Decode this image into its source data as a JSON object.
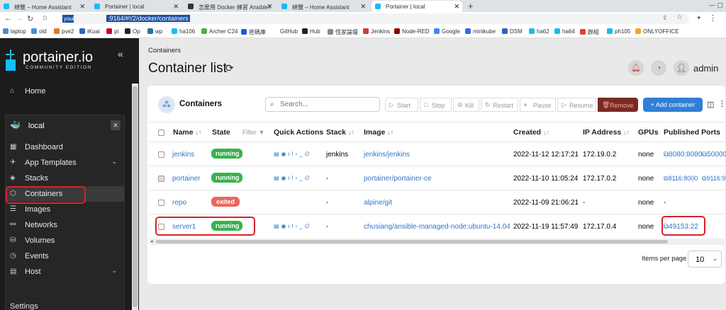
{
  "browser": {
    "tabs": [
      {
        "title": "總覽 – Home Assistant",
        "color": "#18bcf2"
      },
      {
        "title": "Portainer | local",
        "color": "#13bef9"
      },
      {
        "title": "怎麼用 Docker 練習 Ansible？",
        "color": "#333333"
      },
      {
        "title": "總覽 – Home Assistant",
        "color": "#18bcf2"
      },
      {
        "title": "Portainer | local",
        "color": "#13bef9"
      }
    ],
    "url_host": "youl",
    "url_path": ":9164/#!/2/docker/containers",
    "bookmarks": [
      "laptop",
      "old",
      "pve2",
      "iKuai",
      "pi",
      "Op",
      "wp",
      "ha106",
      "Archer C24",
      "密碼庫",
      "GitHub",
      "Hub",
      "恆家論壇",
      "Jenkins",
      "Node-RED",
      "Google",
      "minikube",
      "DSM",
      "ha62",
      "ha64",
      "群組",
      "ph105",
      "ONLYOFFICE"
    ]
  },
  "sidebar": {
    "brand": "portainer.io",
    "edition": "COMMUNITY EDITION",
    "home": "Home",
    "env_name": "local",
    "items": [
      "Dashboard",
      "App Templates",
      "Stacks",
      "Containers",
      "Images",
      "Networks",
      "Volumes",
      "Events",
      "Host"
    ],
    "settings": "Settings"
  },
  "header": {
    "breadcrumb": "Containers",
    "title": "Container list",
    "user": "admin"
  },
  "card": {
    "title": "Containers",
    "search_placeholder": "Search...",
    "actions": {
      "start": "Start",
      "stop": "Stop",
      "kill": "Kill",
      "restart": "Restart",
      "pause": "Pause",
      "resume": "Resume",
      "remove": "Remove",
      "add": "+ Add container"
    }
  },
  "table": {
    "headers": {
      "name": "Name",
      "state": "State",
      "filter": "Filter",
      "quick": "Quick Actions",
      "stack": "Stack",
      "image": "Image",
      "created": "Created",
      "ip": "IP Address",
      "gpus": "GPUs",
      "ports": "Published Ports"
    },
    "rows": [
      {
        "name": "jenkins",
        "state": "running",
        "stack": "jenkins",
        "image": "jenkins/jenkins",
        "created": "2022-11-12 12:17:21",
        "ip": "172.19.0.2",
        "gpus": "none",
        "ports": "8080:8080",
        "ports2": "50000"
      },
      {
        "name": "portainer",
        "state": "running",
        "stack": "-",
        "image": "portainer/portainer-ce",
        "created": "2022-11-10 11:05:24",
        "ip": "172.17.0.2",
        "gpus": "none",
        "ports": "8116:8000",
        "ports2": "9116:9"
      },
      {
        "name": "repo",
        "state": "exited",
        "stack": "-",
        "image": "alpine/git",
        "created": "2022-11-09 21:06:21",
        "ip": "-",
        "gpus": "none",
        "ports": "-",
        "ports2": ""
      },
      {
        "name": "server1",
        "state": "running",
        "stack": "-",
        "image": "chusiang/ansible-managed-node:ubuntu-14.04",
        "created": "2022-11-19 11:57:49",
        "ip": "172.17.0.4",
        "gpus": "none",
        "ports": "49153:22",
        "ports2": ""
      }
    ],
    "items_per_page_label": "Items per page",
    "items_per_page": "10"
  },
  "colors": {
    "running": "#37b24d",
    "exited": "#e8685e",
    "link": "#2f76c8",
    "add": "#2f7fd6",
    "remove": "#7a2a22",
    "highlight": "#d9212c"
  }
}
